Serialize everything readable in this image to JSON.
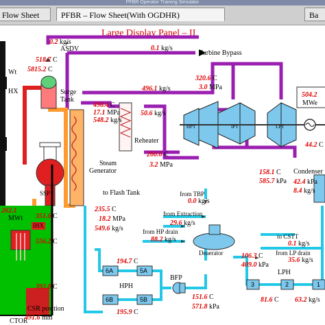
{
  "window": {
    "title": "PFBR  Operator Training Simulator"
  },
  "tabs": [
    {
      "label": "Flow Sheet"
    },
    {
      "label": "PFBR – Flow Sheet(With OGDHR)"
    },
    {
      "label": "Ba"
    }
  ],
  "panel": {
    "title": "Large Display Panel – II"
  },
  "components": {
    "asdv": "ASDV",
    "turbine_bypass": "Turbine Bypass",
    "surge_tank": "Surge\nTank",
    "surge_1": "Surge",
    "surge_2": "Tank",
    "reheater": "Reheater",
    "sg_1": "Steam",
    "sg_2": "Generator",
    "flash_tank": "to Flash Tank",
    "ssp": "SSP",
    "ihx": "IHX",
    "reactor": "CTOR",
    "hpt": "HPT",
    "ipt": "IPT",
    "lpt": "LPT",
    "mwe_unit": "MWe",
    "condenser": "Condenser",
    "from_tbp": "from TBP",
    "from_extraction": "from Extraction",
    "from_hp_drain": "from HP drain",
    "deaerator": "Deaerator",
    "bfp": "BFP",
    "hph": "HPH",
    "lph": "LPH",
    "to_cstt": "to CSTT",
    "from_lp_drain": "from LP drain",
    "csr_position": "CSR position",
    "h6a": "6A",
    "h5a": "5A",
    "h6b": "6B",
    "h5b": "5B",
    "h3": "3",
    "h2": "2",
    "h1": "1",
    "left_wt": "Wt",
    "left_hx": "HX",
    "left_mwt": "MWt"
  },
  "readings": {
    "asdv_flow": {
      "value": "0.2",
      "unit": "kg/s"
    },
    "bypass_flow": {
      "value": "0.1",
      "unit": "kg/s"
    },
    "sh_temp": {
      "value": "518.7",
      "unit": "C"
    },
    "sh_power": {
      "value": "5815.2",
      "unit": "C"
    },
    "hpt_temp": {
      "value": "320.6",
      "unit": "C"
    },
    "hpt_press": {
      "value": "3.0",
      "unit": "MPa"
    },
    "main_flow": {
      "value": "496.1",
      "unit": "kg/s"
    },
    "sg_temp": {
      "value": "498.4",
      "unit": "C"
    },
    "sg_press": {
      "value": "17.1",
      "unit": "MPa"
    },
    "sg_flow": {
      "value": "548.2",
      "unit": "kg/s"
    },
    "rh_flow": {
      "value": "50.6",
      "unit": "kg/s"
    },
    "rh_temp": {
      "value": "260.6",
      "unit": "C"
    },
    "rh_press": {
      "value": "3.2",
      "unit": "MPa"
    },
    "mwe": {
      "value": "504.2"
    },
    "cond_temp": {
      "value": "44.2",
      "unit": "C"
    },
    "lpt_flow": {
      "value": "158.1",
      "unit": "C"
    },
    "lpt_press": {
      "value": "585.7",
      "unit": "kPa"
    },
    "core_power": {
      "value": "262.1"
    },
    "hot_pool": {
      "value": "351.6",
      "unit": "C"
    },
    "cold_pool": {
      "value": "556.2",
      "unit": "C"
    },
    "fw_temp": {
      "value": "235.5",
      "unit": "C"
    },
    "fw_press": {
      "value": "18.2",
      "unit": "MPa"
    },
    "fw_flow": {
      "value": "549.6",
      "unit": "kg/s"
    },
    "ext_flow": {
      "value": "29.6",
      "unit": "kg/s"
    },
    "ext_temp": {
      "value": "0.0",
      "unit": "kg/s"
    },
    "hp_drain": {
      "value": "88.2",
      "unit": "kg/s"
    },
    "h6_out": {
      "value": "194.7",
      "unit": "C"
    },
    "h5_out": {
      "value": "195.9",
      "unit": "C"
    },
    "bfp_temp": {
      "value": "151.6",
      "unit": "C"
    },
    "bfp_press": {
      "value": "571.8",
      "unit": "kPa"
    },
    "lph_temp": {
      "value": "106.3",
      "unit": "C"
    },
    "lph_press": {
      "value": "409.0",
      "unit": "kPa"
    },
    "cond_out": {
      "value": "81.6",
      "unit": "C"
    },
    "lph_flow": {
      "value": "63.2",
      "unit": "kg/s"
    },
    "c_temp": {
      "value": "42.4",
      "unit": "kPa"
    },
    "c_flow": {
      "value": "8.4",
      "unit": "kg/s"
    },
    "cstt": {
      "value": "0.1",
      "unit": "kg/s"
    },
    "lp_drain": {
      "value": "35.6",
      "unit": "kg/s"
    },
    "reactor_temp": {
      "value": "392.8",
      "unit": "C"
    },
    "csr": {
      "value": "491.6",
      "unit": "mm"
    }
  },
  "colors": {
    "steam": "#9a1fb0",
    "feedwater": "#22c8e6",
    "sodium_hot": "#e02020",
    "sodium_cold": "#ff9a2e",
    "readout": "#e00000"
  }
}
